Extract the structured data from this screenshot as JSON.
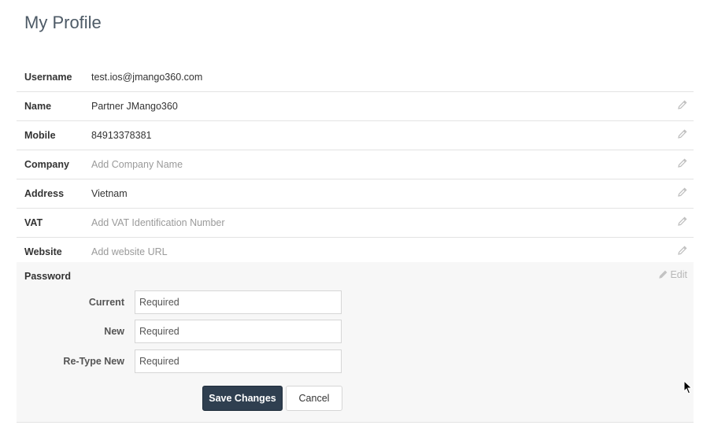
{
  "page": {
    "title": "My Profile"
  },
  "profile": {
    "rows": [
      {
        "label": "Username",
        "value": "test.ios@jmango360.com",
        "editable": false,
        "placeholder": false
      },
      {
        "label": "Name",
        "value": "Partner JMango360",
        "editable": true,
        "placeholder": false
      },
      {
        "label": "Mobile",
        "value": "84913378381",
        "editable": true,
        "placeholder": false
      },
      {
        "label": "Company",
        "value": "Add Company Name",
        "editable": true,
        "placeholder": true
      },
      {
        "label": "Address",
        "value": "Vietnam",
        "editable": true,
        "placeholder": false
      },
      {
        "label": "VAT",
        "value": "Add VAT Identification Number",
        "editable": true,
        "placeholder": true
      },
      {
        "label": "Website",
        "value": "Add website URL",
        "editable": true,
        "placeholder": true
      }
    ]
  },
  "password": {
    "label": "Password",
    "edit_label": "Edit",
    "fields": [
      {
        "label": "Current",
        "placeholder": "Required"
      },
      {
        "label": "New",
        "placeholder": "Required"
      },
      {
        "label": "Re-Type New",
        "placeholder": "Required"
      }
    ],
    "save_label": "Save Changes",
    "cancel_label": "Cancel"
  },
  "icons": {
    "edit": "pencil-icon",
    "cursor": "mouse-pointer-icon"
  },
  "colors": {
    "primary_button": "#2f3f50",
    "title": "#4d5a66",
    "placeholder_text": "#9a9a9a"
  }
}
